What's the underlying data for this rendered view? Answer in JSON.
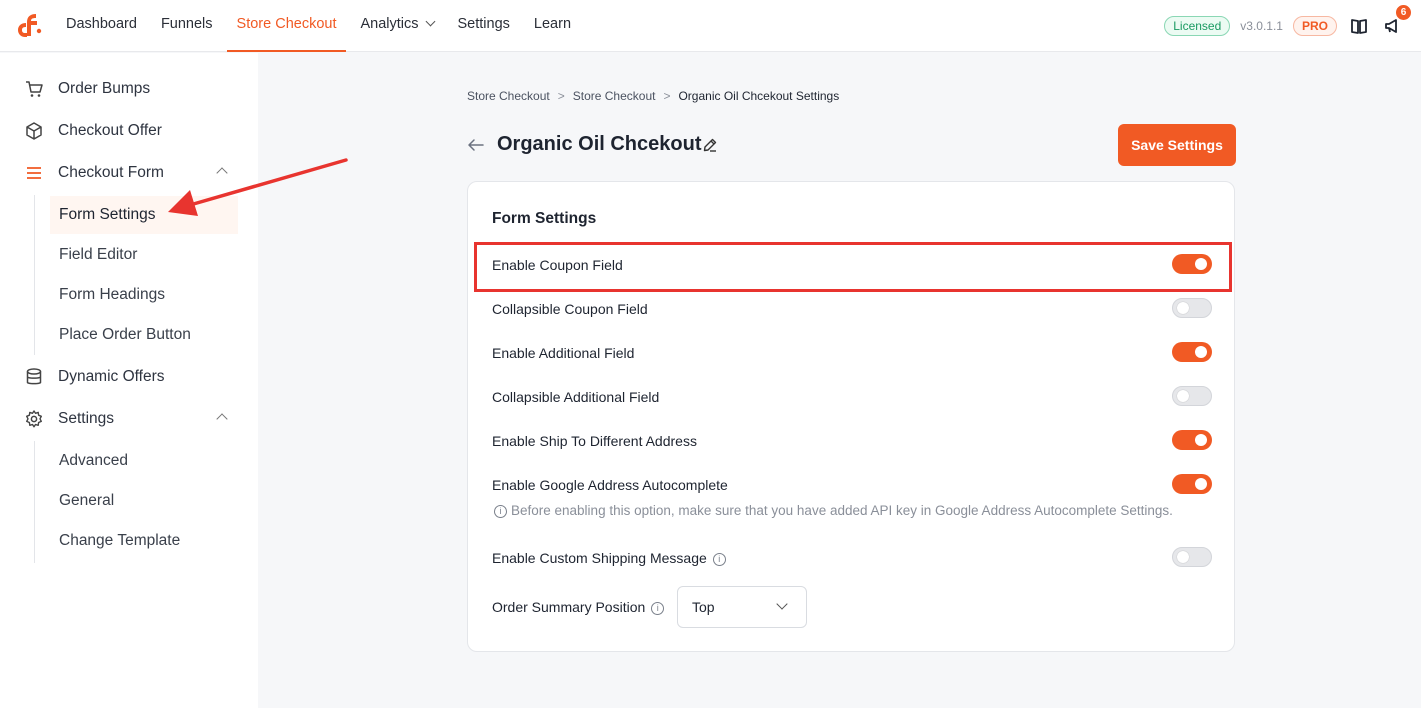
{
  "nav": {
    "items": [
      {
        "label": "Dashboard",
        "active": false
      },
      {
        "label": "Funnels",
        "active": false
      },
      {
        "label": "Store Checkout",
        "active": true
      },
      {
        "label": "Analytics",
        "active": false
      },
      {
        "label": "Settings",
        "active": false
      },
      {
        "label": "Learn",
        "active": false
      }
    ],
    "licensed_label": "Licensed",
    "version": "v3.0.1.1",
    "pro_label": "PRO",
    "notification_count": "6"
  },
  "sidebar": {
    "items": [
      {
        "label": "Order Bumps",
        "icon": "cart-icon"
      },
      {
        "label": "Checkout Offer",
        "icon": "box-icon"
      },
      {
        "label": "Checkout Form",
        "icon": "menu-icon"
      },
      {
        "label": "Dynamic Offers",
        "icon": "database-icon"
      },
      {
        "label": "Settings",
        "icon": "gear-icon"
      }
    ],
    "checkout_form_sub": [
      "Form Settings",
      "Field Editor",
      "Form Headings",
      "Place Order Button"
    ],
    "settings_sub": [
      "Advanced",
      "General",
      "Change Template"
    ],
    "active_sub": "Form Settings"
  },
  "breadcrumb": [
    "Store Checkout",
    "Store Checkout",
    "Organic Oil Chcekout Settings"
  ],
  "page": {
    "title": "Organic Oil Chcekout",
    "save_label": "Save Settings"
  },
  "form_settings": {
    "title": "Form Settings",
    "rows": [
      {
        "label": "Enable Coupon Field",
        "enabled": true
      },
      {
        "label": "Collapsible Coupon Field",
        "enabled": false
      },
      {
        "label": "Enable Additional Field",
        "enabled": true
      },
      {
        "label": "Collapsible Additional Field",
        "enabled": false
      },
      {
        "label": "Enable Ship To Different Address",
        "enabled": true
      },
      {
        "label": "Enable Google Address Autocomplete",
        "enabled": true
      },
      {
        "label": "Enable Custom Shipping Message",
        "enabled": false
      }
    ],
    "hint": "Before enabling this option, make sure that you have added API key in Google Address Autocomplete Settings.",
    "order_summary_label": "Order Summary Position",
    "order_summary_value": "Top"
  },
  "colors": {
    "accent": "#f15a24",
    "annotation": "#e8342f"
  }
}
